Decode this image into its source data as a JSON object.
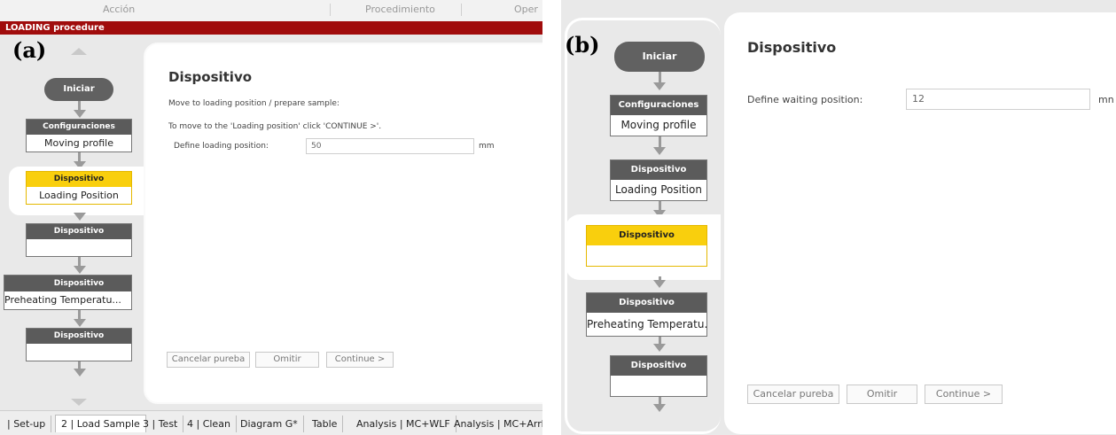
{
  "panel_a": {
    "figure_label": "(a)",
    "top_menu": [
      "Acción",
      "Procedimiento",
      "Oper"
    ],
    "procedure_bar": "LOADING procedure",
    "start_label": "Iniciar",
    "steps": [
      {
        "head": "Configuraciones",
        "body": "Moving profile"
      },
      {
        "head": "Dispositivo",
        "body": "Loading Position"
      },
      {
        "head": "Dispositivo",
        "body": ""
      },
      {
        "head": "Dispositivo",
        "body": "Preheating Temperatu..."
      },
      {
        "head": "Dispositivo",
        "body": ""
      }
    ],
    "content": {
      "title": "Dispositivo",
      "line1": "Move to loading position / prepare sample:",
      "line2": "To move to the 'Loading position' click 'CONTINUE >'.",
      "field_label": "Define loading position:",
      "field_value": "50",
      "field_unit": "mm",
      "cancel": "Cancelar pureba",
      "skip": "Omitir",
      "continue": "Continue >"
    },
    "tabs": [
      "| Set-up",
      "2 | Load Sample",
      "3 | Test",
      "4 | Clean",
      "Diagram G*",
      "Table",
      "Analysis | MC+WLF",
      "Analysis | MC+Arrh"
    ]
  },
  "panel_b": {
    "figure_label": "(b)",
    "start_label": "Iniciar",
    "steps": [
      {
        "head": "Configuraciones",
        "body": "Moving profile"
      },
      {
        "head": "Dispositivo",
        "body": "Loading Position"
      },
      {
        "head": "Dispositivo",
        "body": ""
      },
      {
        "head": "Dispositivo",
        "body": "Preheating Temperatu..."
      },
      {
        "head": "Dispositivo",
        "body": ""
      }
    ],
    "content": {
      "title": "Dispositivo",
      "field_label": "Define waiting position:",
      "field_value": "12",
      "field_unit": "mn",
      "cancel": "Cancelar pureba",
      "skip": "Omitir",
      "continue": "Continue >"
    }
  },
  "colors": {
    "procedure_bar": "#a00c0c",
    "active_step": "#f9cf0d",
    "step_head": "#5b5b5b"
  }
}
